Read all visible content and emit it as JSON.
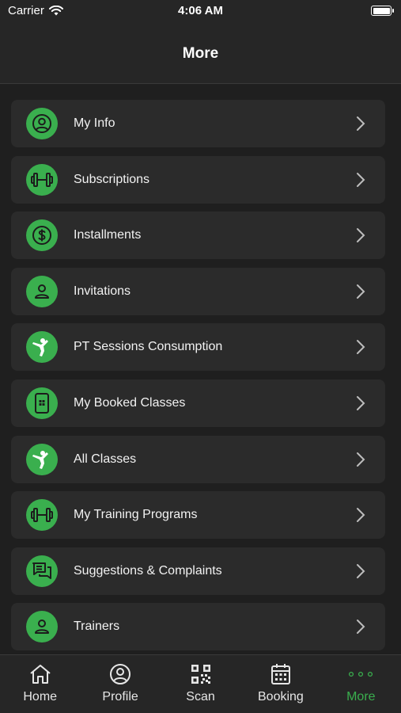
{
  "status_bar": {
    "carrier": "Carrier",
    "time": "4:06 AM"
  },
  "header": {
    "title": "More"
  },
  "colors": {
    "accent": "#3aaf4e",
    "background": "#1f1f1f",
    "card": "#2b2b2b"
  },
  "menu": {
    "items": [
      {
        "label": "My Info",
        "icon": "user-circle-icon"
      },
      {
        "label": "Subscriptions",
        "icon": "dumbbell-icon"
      },
      {
        "label": "Installments",
        "icon": "dollar-circle-icon"
      },
      {
        "label": "Invitations",
        "icon": "person-icon"
      },
      {
        "label": "PT Sessions Consumption",
        "icon": "karate-icon"
      },
      {
        "label": "My Booked Classes",
        "icon": "phone-class-icon"
      },
      {
        "label": "All Classes",
        "icon": "karate-icon"
      },
      {
        "label": "My Training Programs",
        "icon": "dumbbell-icon"
      },
      {
        "label": "Suggestions & Complaints",
        "icon": "chat-bubbles-icon"
      },
      {
        "label": "Trainers",
        "icon": "person-icon"
      }
    ]
  },
  "tabs": [
    {
      "label": "Home",
      "icon": "home-icon"
    },
    {
      "label": "Profile",
      "icon": "profile-icon"
    },
    {
      "label": "Scan",
      "icon": "qr-code-icon"
    },
    {
      "label": "Booking",
      "icon": "calendar-icon"
    },
    {
      "label": "More",
      "icon": "more-dots-icon",
      "active": true
    }
  ]
}
